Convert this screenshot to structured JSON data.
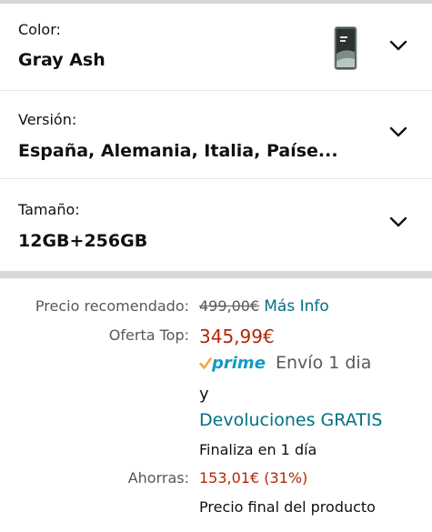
{
  "variants": [
    {
      "label": "Color:",
      "value": "Gray Ash"
    },
    {
      "label": "Versión:",
      "value": "España, Alemania, Italia, Paíse..."
    },
    {
      "label": "Tamaño:",
      "value": "12GB+256GB"
    }
  ],
  "pricing": {
    "list_price_label": "Precio recomendado:",
    "list_price": "499,00€",
    "more_info_link": "Más Info",
    "deal_label": "Oferta Top:",
    "deal_price": "345,99€",
    "prime_text": "prime",
    "shipping_text": "Envío 1 dia",
    "and_text": "y",
    "returns_link": "Devoluciones GRATIS",
    "deal_ends": "Finaliza en 1 día",
    "savings_label": "Ahorras:",
    "savings_value": "153,01€ (31%)",
    "final_price_note": "Precio final del producto"
  },
  "colors": {
    "accent_link": "#007185",
    "price_red": "#b12704",
    "prime_blue": "#1399c6",
    "prime_orange": "#f3a847"
  },
  "icons": [
    "phone-thumbnail",
    "chevron-down-icon",
    "prime-check-icon"
  ]
}
